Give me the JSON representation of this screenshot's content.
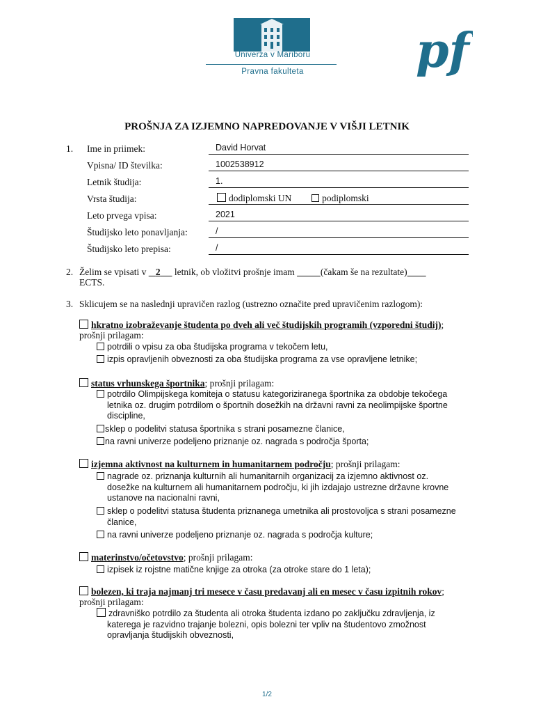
{
  "header": {
    "university": "Univerza v Mariboru",
    "faculty": "Pravna fakulteta",
    "logo_mark": "pf"
  },
  "title": "PROŠNJA ZA IZJEMNO NAPREDOVANJE V VIŠJI LETNIK",
  "section1": {
    "number": "1.",
    "fields": [
      {
        "label": "Ime in priimek:",
        "value": "David Horvat"
      },
      {
        "label": "Vpisna/ ID številka:",
        "value": "1002538912"
      },
      {
        "label": "Letnik študija:",
        "value": "1."
      },
      {
        "label": "Vrsta študija:",
        "value": ""
      },
      {
        "label": "Leto prvega vpisa:",
        "value": "2021"
      },
      {
        "label": "Študijsko leto ponavljanja:",
        "value": "/"
      },
      {
        "label": "Študijsko leto prepisa:",
        "value": "/"
      }
    ],
    "study_type_options": [
      "dodiplomski UN",
      "podiplomski"
    ]
  },
  "section2": {
    "number": "2.",
    "pre": "Želim se vpisati v",
    "year": "2",
    "mid": "letnik, ob vložitvi prošnje imam",
    "post": "(čakam še na rezultate)",
    "ects": "ECTS."
  },
  "section3": {
    "number": "3.",
    "intro": "Sklicujem se na naslednji upravičen razlog (ustrezno označite pred upravičenim razlogom):",
    "reasons": [
      {
        "title": "hkratno izobraževanje študenta po dveh ali več študijskih programih (vzporedni študij)",
        "suffix": ";",
        "attach": "prošnji prilagam:",
        "items": [
          [
            "potrdili o vpisu za oba študijska programa v tekočem letu,"
          ],
          [
            "izpis opravljenih obveznosti za oba študijska programa za vse opravljene letnike;"
          ]
        ]
      },
      {
        "title": "status vrhunskega športnika",
        "suffix": "; prošnji prilagam:",
        "attach": "",
        "items": [
          [
            "potrdilo Olimpijskega komiteja o statusu kategoriziranega športnika za obdobje tekočega",
            "letnika oz. drugim potrdilom o športnih dosežkih na državni ravni za neolimpijske športne",
            "discipline,"
          ],
          [
            "sklep o podelitvi statusa športnika s strani posamezne članice,"
          ],
          [
            "na ravni univerze podeljeno priznanje oz. nagrada s področja športa;"
          ]
        ]
      },
      {
        "title": "izjemna aktivnost na kulturnem in humanitarnem področju",
        "suffix": "; prošnji prilagam:",
        "attach": "",
        "items": [
          [
            "nagrade oz. priznanja kulturnih ali humanitarnih organizacij za izjemno aktivnost oz.",
            "dosežke na kulturnem ali humanitarnem področju, ki jih izdajajo ustrezne državne krovne",
            "ustanove na nacionalni ravni,"
          ],
          [
            "sklep o podelitvi statusa študenta priznanega umetnika ali prostovoljca s strani posamezne",
            "članice,"
          ],
          [
            "na ravni univerze podeljeno priznanje oz. nagrada s področja kulture;"
          ]
        ]
      },
      {
        "title": "materinstvo/očetovstvo",
        "suffix": "; prošnji prilagam:",
        "attach": "",
        "items": [
          [
            "izpisek iz rojstne matične knjige za otroka (za otroke stare do 1 leta);"
          ]
        ]
      },
      {
        "title": "bolezen, ki traja najmanj tri mesece v času predavanj ali en mesec v času izpitnih rokov",
        "suffix": ";",
        "attach": "prošnji prilagam:",
        "items": [
          [
            "zdravniško potrdilo za študenta ali otroka študenta izdano po zaključku zdravljenja, iz",
            "katerega je razvidno trajanje bolezni, opis bolezni ter vpliv na študentovo zmožnost",
            "opravljanja študijskih obveznosti,"
          ]
        ]
      }
    ]
  },
  "footer": {
    "page": "1/2"
  },
  "colors": {
    "brand": "#1f6e8c"
  }
}
